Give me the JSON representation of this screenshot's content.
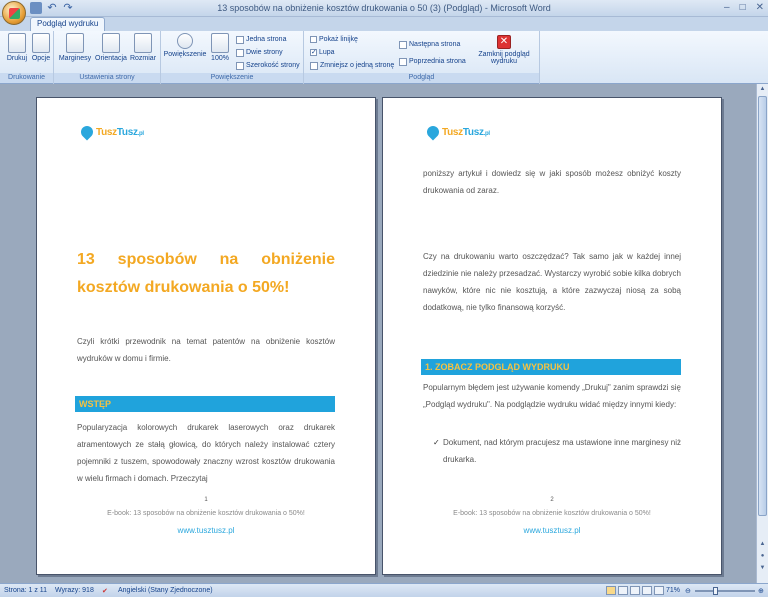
{
  "window": {
    "title": "13 sposobów na obniżenie kosztów drukowania o 50 (3) (Podgląd) - Microsoft Word",
    "minimize": "–",
    "maximize": "□",
    "close": "✕"
  },
  "quick_access": {
    "undo": "↶",
    "redo": "↷"
  },
  "ribbon": {
    "active_tab": "Podgląd wydruku",
    "groups": {
      "print": {
        "label": "Drukowanie",
        "print_button": "Drukuj",
        "options_button": "Opcje"
      },
      "page_setup": {
        "label": "Ustawienia strony",
        "margins_button": "Marginesy",
        "orientation_button": "Orientacja",
        "size_button": "Rozmiar"
      },
      "zoom": {
        "label": "Powiększenie",
        "zoom_button": "Powiększenie",
        "hundred_button": "100%",
        "one_page": "Jedna strona",
        "two_pages": "Dwie strony",
        "page_width": "Szerokość strony"
      },
      "preview": {
        "label": "Podgląd",
        "show_ruler": "Pokaż linijkę",
        "magnifier": "Lupa",
        "shrink_one_page": "Zmniejsz o jedną stronę",
        "next_page": "Następna strona",
        "prev_page": "Poprzednia strona",
        "close_preview_line1": "Zamknij podgląd",
        "close_preview_line2": "wydruku"
      }
    }
  },
  "page1": {
    "logo_a": "Tusz",
    "logo_b": "Tusz",
    "logo_c": ".pl",
    "title_line1": "13 sposobów na obniżenie",
    "title_line2": "kosztów drukowania o 50%!",
    "intro": "Czyli krótki przewodnik na temat patentów na obniżenie kosztów wydruków w domu i firmie.",
    "section_heading": "WSTĘP",
    "body": "Popularyzacja kolorowych drukarek laserowych oraz drukarek atramentowych ze stałą głowicą, do których należy instalować cztery pojemniki z tuszem, spowodowały znaczny wzrost kosztów drukowania w wielu firmach i domach. Przeczytaj",
    "page_number": "1",
    "footer_text": "E-book: 13 sposobów na obniżenie kosztów drukowania o 50%!",
    "footer_link": "www.tusztusz.pl"
  },
  "page2": {
    "logo_a": "Tusz",
    "logo_b": "Tusz",
    "logo_c": ".pl",
    "para1": "poniższy artykuł i dowiedz się w jaki sposób możesz obniżyć koszty drukowania od zaraz.",
    "para2": "Czy na drukowaniu warto oszczędzać? Tak samo jak w każdej innej dziedzinie nie należy przesadzać. Wystarczy wyrobić sobie kilka dobrych nawyków, które nic nie kosztują, a które zazwyczaj niosą za sobą dodatkową, nie tylko finansową korzyść.",
    "section_heading": "1. ZOBACZ PODGLĄD WYDRUKU",
    "para3": "Popularnym błędem jest używanie komendy „Drukuj\" zanim sprawdzi się „Podgląd wydruku\". Na podglądzie wydruku widać między innymi kiedy:",
    "bullet1": "Dokument, nad którym pracujesz ma ustawione inne marginesy niż drukarka.",
    "page_number": "2",
    "footer_text": "E-book: 13 sposobów na obniżenie kosztów drukowania o 50%!",
    "footer_link": "www.tusztusz.pl"
  },
  "status": {
    "page": "Strona: 1 z 11",
    "words": "Wyrazy: 918",
    "language": "Angielski (Stany Zjednoczone)",
    "zoom": "71%",
    "zoom_level_percent": 71
  },
  "colors": {
    "accent_orange": "#f3a822",
    "accent_blue": "#20a3dc",
    "ribbon_text": "#15428b"
  }
}
